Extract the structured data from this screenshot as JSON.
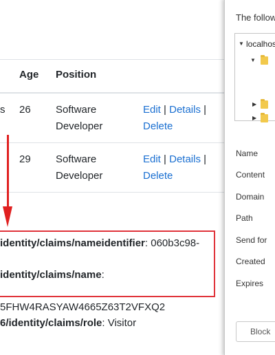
{
  "table": {
    "headers": {
      "age": "Age",
      "position": "Position"
    },
    "rows": [
      {
        "name_fragment": "s",
        "age": "26",
        "position_line1": "Software",
        "position_line2": "Developer",
        "edit": "Edit",
        "details": "Details",
        "delete": "Delete",
        "sep1": "|",
        "sep2": "|"
      },
      {
        "name_fragment": "",
        "age": "29",
        "position_line1": "Software",
        "position_line2": "Developer",
        "edit": "Edit",
        "details": "Details",
        "delete": "Delete",
        "sep1": "|",
        "sep2": "|"
      }
    ]
  },
  "claims": [
    {
      "key": "identity/claims/nameidentifier",
      "value": ": 060b3c98-"
    },
    {
      "key": "identity/claims/name",
      "value": ":"
    },
    {
      "key": "",
      "value": "5FHW4RASYAW4665Z63T2VFXQ2"
    },
    {
      "key": "6/identity/claims/role",
      "value": ": Visitor"
    }
  ],
  "dialog": {
    "intro": "The follow",
    "tree_root": "localhos",
    "fields": [
      "Name",
      "Content",
      "Domain",
      "Path",
      "Send for",
      "Created",
      "Expires"
    ],
    "block_button": "Block"
  },
  "colors": {
    "link": "#1a6fd1",
    "annotation_red": "#e0333a"
  },
  "icons": [
    "arrow-down-annotation",
    "folder-icon",
    "tree-expand-icon",
    "tree-collapse-icon"
  ]
}
